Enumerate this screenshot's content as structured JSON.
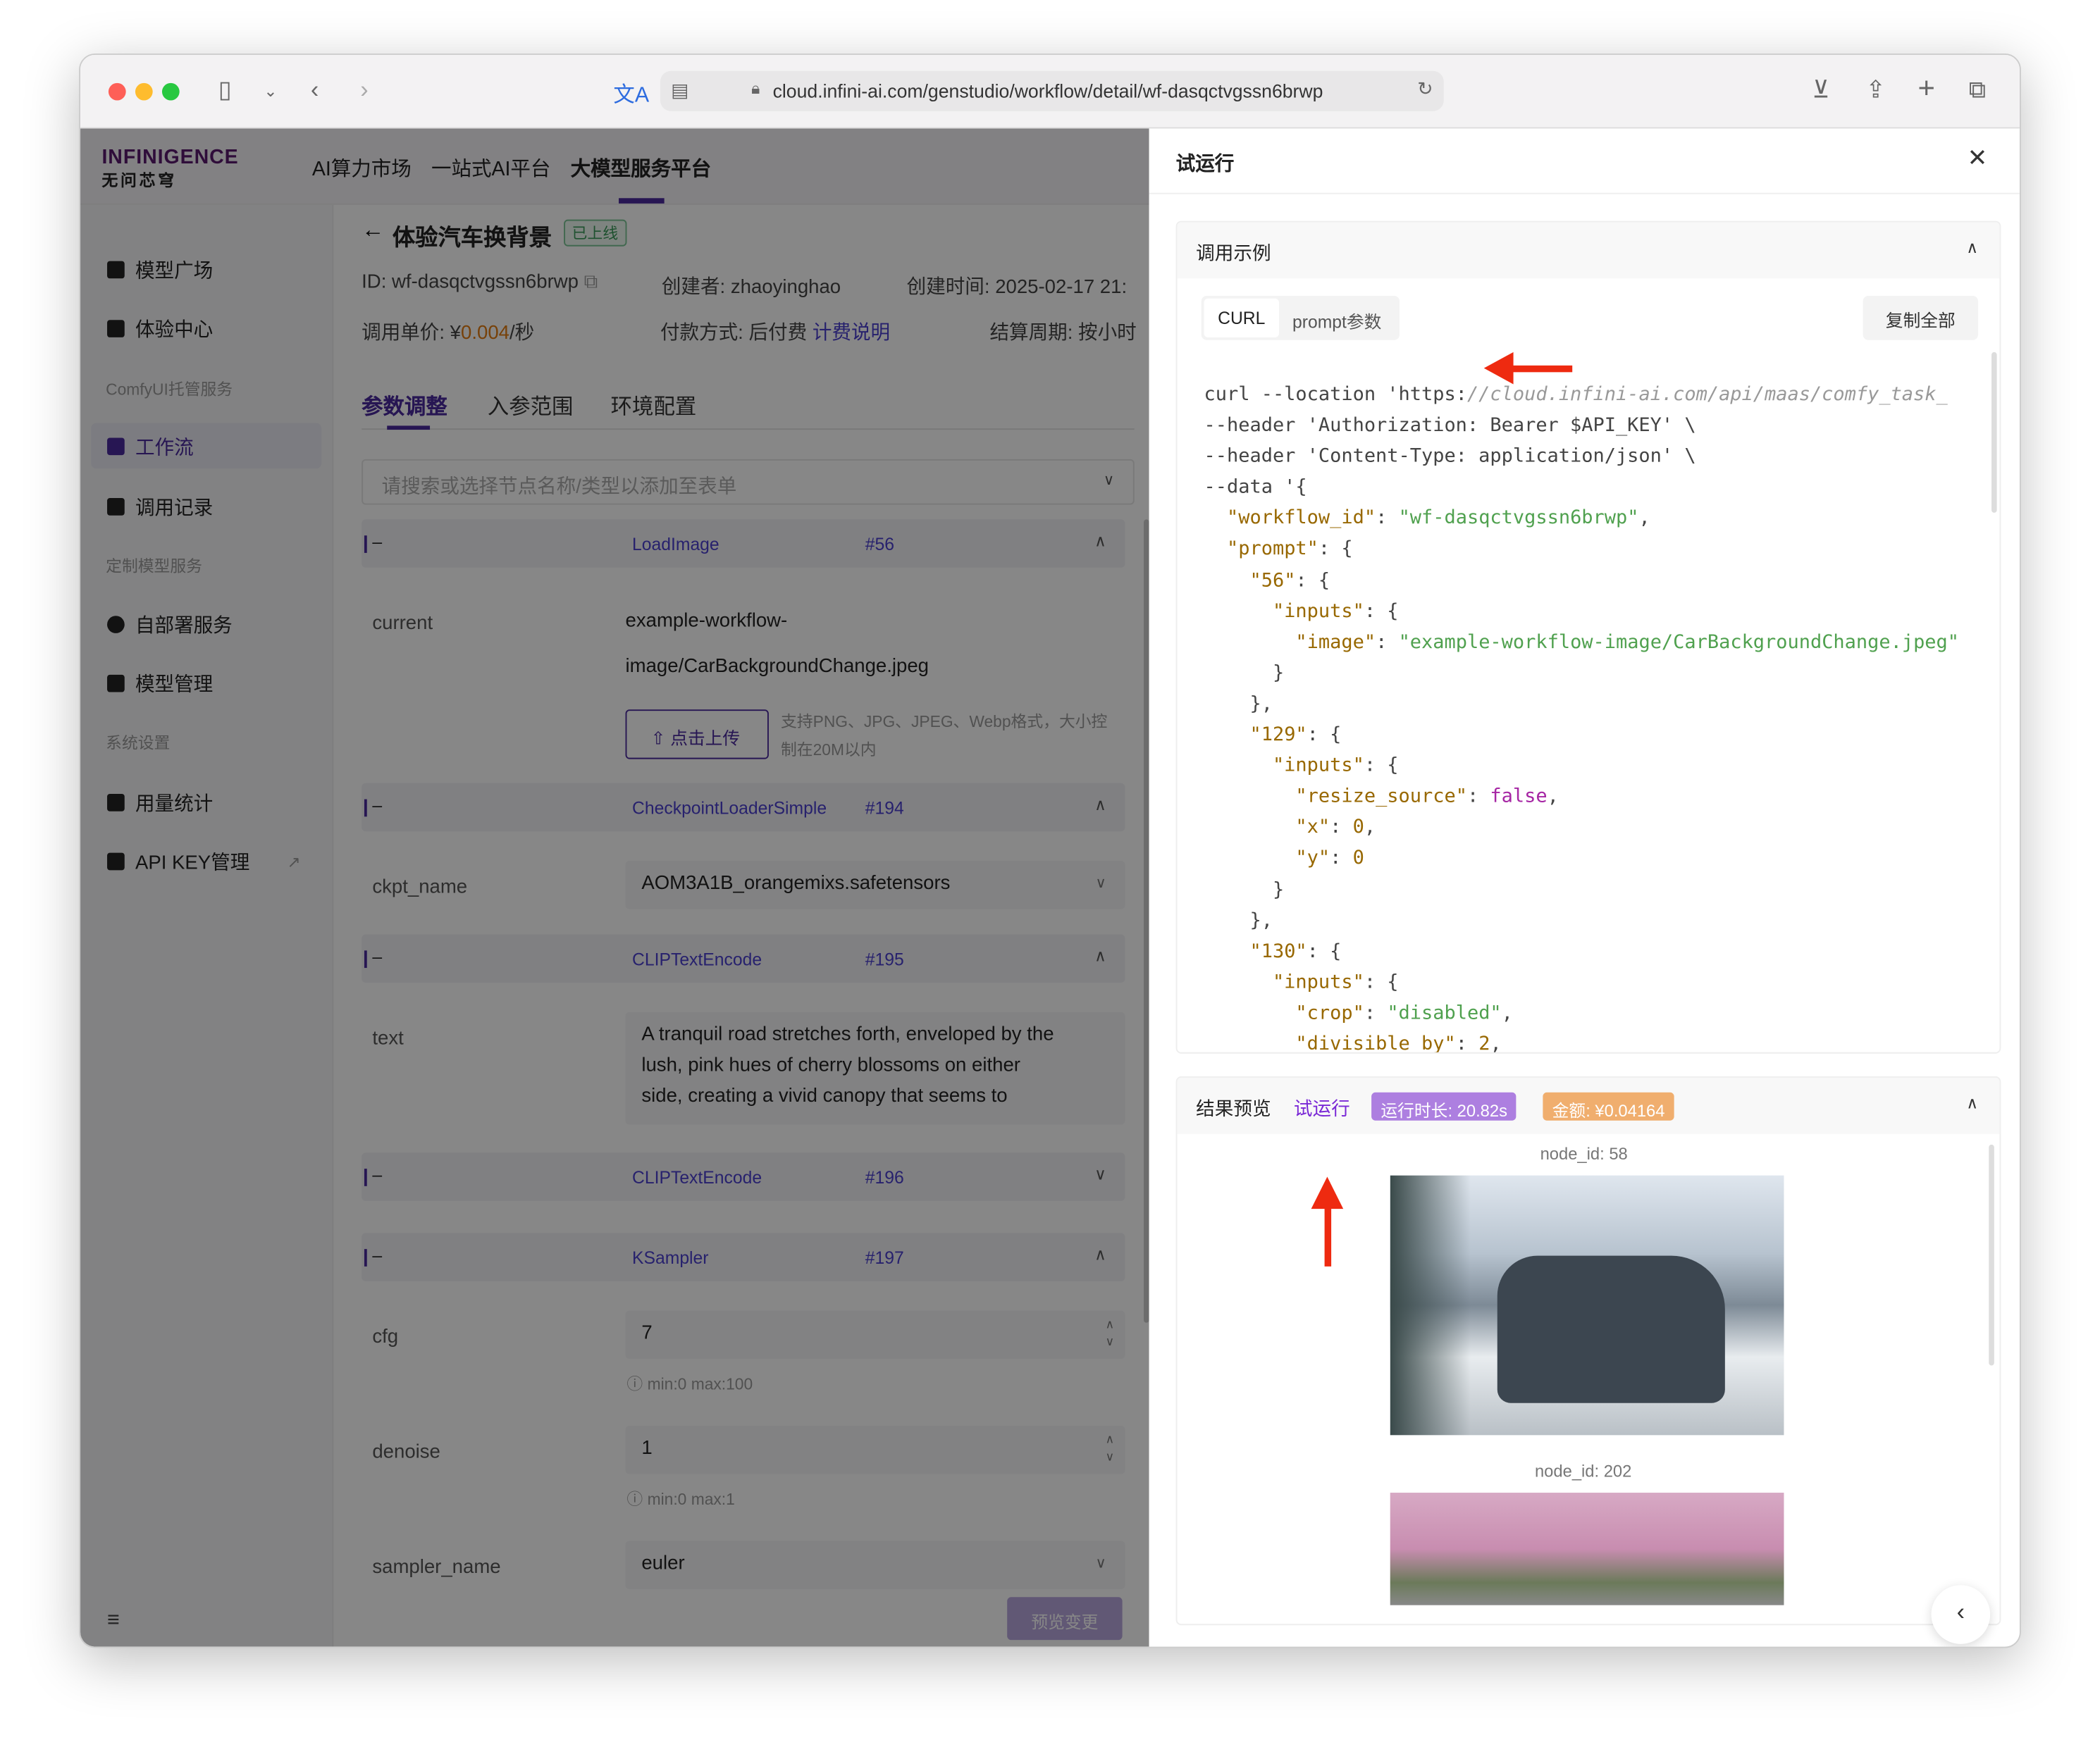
{
  "browser": {
    "url": "cloud.infini-ai.com/genstudio/workflow/detail/wf-dasqctvgssn6brwp"
  },
  "topnav": {
    "logo": "INFINIGENCE",
    "logo_cn": "无问芯穹",
    "items": [
      "AI算力市场",
      "一站式AI平台",
      "大模型服务平台"
    ]
  },
  "sidebar": {
    "items": [
      {
        "label": "模型广场"
      },
      {
        "label": "体验中心"
      },
      {
        "group": "ComfyUI托管服务"
      },
      {
        "label": "工作流",
        "active": true
      },
      {
        "label": "调用记录"
      },
      {
        "group": "定制模型服务"
      },
      {
        "label": "自部署服务"
      },
      {
        "label": "模型管理"
      },
      {
        "group": "系统设置"
      },
      {
        "label": "用量统计"
      },
      {
        "label": "API KEY管理"
      }
    ]
  },
  "detail": {
    "title": "体验汽车换背景",
    "status": "已上线",
    "id_label": "ID:",
    "id": "wf-dasqctvgssn6brwp",
    "creator_label": "创建者:",
    "creator": "zhaoyinghao",
    "created_label": "创建时间:",
    "created": "2025-02-17 21:",
    "price_label": "调用单价:",
    "price_prefix": "¥",
    "price": "0.004",
    "price_unit": "/秒",
    "pay_label": "付款方式:",
    "pay": "后付费",
    "pay_link": "计费说明",
    "cycle_label": "结算周期:",
    "cycle": "按小时"
  },
  "tabs": [
    "参数调整",
    "入参范围",
    "环境配置"
  ],
  "search_placeholder": "请搜索或选择节点名称/类型以添加至表单",
  "nodes": [
    {
      "name": "LoadImage",
      "id": "#56"
    },
    {
      "name": "CheckpointLoaderSimple",
      "id": "#194"
    },
    {
      "name": "CLIPTextEncode",
      "id": "#195"
    },
    {
      "name": "CLIPTextEncode",
      "id": "#196"
    },
    {
      "name": "KSampler",
      "id": "#197"
    }
  ],
  "fields": {
    "current_label": "current",
    "current_1": "example-workflow-",
    "current_2": "image/CarBackgroundChange.jpeg",
    "upload": "点击上传",
    "upload_hint_1": "支持PNG、JPG、JPEG、Webp格式，大小控",
    "upload_hint_2": "制在20M以内",
    "ckpt_label": "ckpt_name",
    "ckpt": "AOM3A1B_orangemixs.safetensors",
    "text_label": "text",
    "text_1": "A tranquil road stretches forth, enveloped by the",
    "text_2": "lush, pink hues of cherry blossoms on either",
    "text_3": "side, creating a vivid canopy that seems to",
    "cfg_label": "cfg",
    "cfg": "7",
    "cfg_hint": "min:0  max:100",
    "denoise_label": "denoise",
    "denoise": "1",
    "denoise_hint": "min:0  max:1",
    "sampler_label": "sampler_name",
    "sampler": "euler"
  },
  "preview_button": "预览变更",
  "panel": {
    "title": "试运行",
    "example_title": "调用示例",
    "tab_curl": "CURL",
    "tab_prompt": "prompt参数",
    "copy_all": "复制全部",
    "result_title": "结果预览",
    "run": "试运行",
    "duration": "运行时长: 20.82s",
    "cost": "金额: ¥0.04164",
    "outputs": [
      {
        "label": "node_id: 58"
      },
      {
        "label": "node_id: 202"
      }
    ]
  },
  "code": [
    [
      [
        "curl --location 'https:",
        ""
      ],
      [
        "//cloud.infini-ai.com/api/maas/comfy_task_",
        "u"
      ]
    ],
    [
      [
        "--header 'Authorization: Bearer $API_KEY' \\",
        ""
      ]
    ],
    [
      [
        "--header 'Content-Type: application/json' \\",
        ""
      ]
    ],
    [
      [
        "--data '{",
        ""
      ]
    ],
    [
      [
        "  ",
        ""
      ],
      [
        "\"workflow_id\"",
        "k"
      ],
      [
        ": ",
        ""
      ],
      [
        "\"wf-dasqctvgssn6brwp\"",
        "s"
      ],
      [
        ",",
        ""
      ]
    ],
    [
      [
        "  ",
        ""
      ],
      [
        "\"prompt\"",
        "k"
      ],
      [
        ": {",
        ""
      ]
    ],
    [
      [
        "    ",
        ""
      ],
      [
        "\"56\"",
        "k"
      ],
      [
        ": {",
        ""
      ]
    ],
    [
      [
        "      ",
        ""
      ],
      [
        "\"inputs\"",
        "k"
      ],
      [
        ": {",
        ""
      ]
    ],
    [
      [
        "        ",
        ""
      ],
      [
        "\"image\"",
        "k"
      ],
      [
        ": ",
        ""
      ],
      [
        "\"example-workflow-image/CarBackgroundChange.jpeg\"",
        "s"
      ]
    ],
    [
      [
        "      }",
        ""
      ]
    ],
    [
      [
        "    },",
        ""
      ]
    ],
    [
      [
        "    ",
        ""
      ],
      [
        "\"129\"",
        "k"
      ],
      [
        ": {",
        ""
      ]
    ],
    [
      [
        "      ",
        ""
      ],
      [
        "\"inputs\"",
        "k"
      ],
      [
        ": {",
        ""
      ]
    ],
    [
      [
        "        ",
        ""
      ],
      [
        "\"resize_source\"",
        "k"
      ],
      [
        ": ",
        ""
      ],
      [
        "false",
        "b"
      ],
      [
        ",",
        ""
      ]
    ],
    [
      [
        "        ",
        ""
      ],
      [
        "\"x\"",
        "k"
      ],
      [
        ": ",
        ""
      ],
      [
        "0",
        "n"
      ],
      [
        ",",
        ""
      ]
    ],
    [
      [
        "        ",
        ""
      ],
      [
        "\"y\"",
        "k"
      ],
      [
        ": ",
        ""
      ],
      [
        "0",
        "n"
      ]
    ],
    [
      [
        "      }",
        ""
      ]
    ],
    [
      [
        "    },",
        ""
      ]
    ],
    [
      [
        "    ",
        ""
      ],
      [
        "\"130\"",
        "k"
      ],
      [
        ": {",
        ""
      ]
    ],
    [
      [
        "      ",
        ""
      ],
      [
        "\"inputs\"",
        "k"
      ],
      [
        ": {",
        ""
      ]
    ],
    [
      [
        "        ",
        ""
      ],
      [
        "\"crop\"",
        "k"
      ],
      [
        ": ",
        ""
      ],
      [
        "\"disabled\"",
        "s"
      ],
      [
        ",",
        ""
      ]
    ],
    [
      [
        "        ",
        ""
      ],
      [
        "\"divisible_by\"",
        "k"
      ],
      [
        ": ",
        ""
      ],
      [
        "2",
        "n"
      ],
      [
        ",",
        ""
      ]
    ]
  ],
  "colors": {
    "accent": "#4a2a9e",
    "link": "#7a28d6",
    "duration_badge": "#ad7fe0",
    "cost_badge": "#f0ae6e",
    "annotation_arrow": "#ee2a10"
  }
}
